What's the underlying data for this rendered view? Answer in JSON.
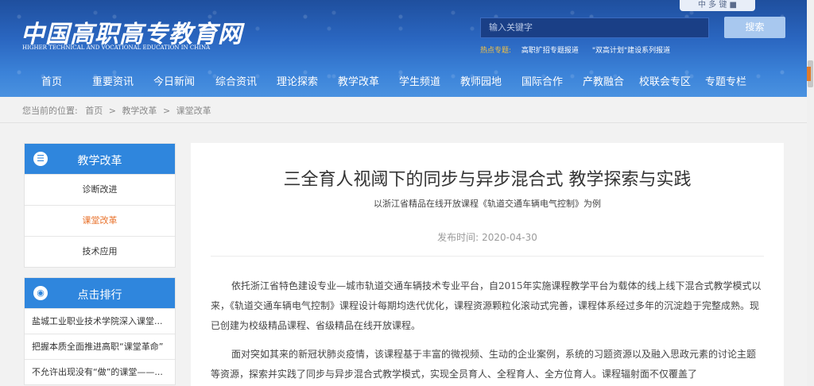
{
  "header": {
    "logo_cn": "中国高职高专教育网",
    "logo_en": "HIGHER TECHNICAL AND VOCATIONAL EDUCATION IN CHINA",
    "corner_badge": "中 多 键 ■",
    "search_placeholder": "输入关键字",
    "search_button": "搜索",
    "hot_label": "热点专题:",
    "hot_links": [
      "高职扩招专题报道",
      "\"双高计划\"建设系列报道"
    ],
    "nav": [
      "首页",
      "重要资讯",
      "今日新闻",
      "综合资讯",
      "理论探索",
      "教学改革",
      "学生频道",
      "教师园地",
      "国际合作",
      "产教融合",
      "校联会专区",
      "专题专栏"
    ]
  },
  "breadcrumb": {
    "prefix": "您当前的位置:",
    "items": [
      "首页",
      "教学改革",
      "课堂改革"
    ],
    "separator": ">"
  },
  "sidebar": {
    "category": {
      "icon": "list-icon",
      "title": "教学改革",
      "items": [
        "诊断改进",
        "课堂改革",
        "技术应用"
      ],
      "active": "课堂改革"
    },
    "ranking": {
      "icon": "target-icon",
      "title": "点击排行",
      "items": [
        "盐城工业职业技术学院深入课堂...",
        "把握本质全面推进高职“课堂革命”",
        "不允许出现没有“做”的课堂——..."
      ]
    }
  },
  "article": {
    "title": "三全育人视阈下的同步与异步混合式 教学探索与实践",
    "subtitle": "以浙江省精品在线开放课程《轨道交通车辆电气控制》为例",
    "date_label": "发布时间:",
    "date": "2020-04-30",
    "paragraphs": [
      "依托浙江省特色建设专业—城市轨道交通车辆技术专业平台，自2015年实施课程教学平台为载体的线上线下混合式教学模式以来，《轨道交通车辆电气控制》课程设计每期均迭代优化，课程资源颗粒化滚动式完善，课程体系经过多年的沉淀趋于完整成熟。现已创建为校级精品课程、省级精品在线开放课程。",
      "面对突如其来的新冠状肺炎疫情，该课程基于丰富的微视频、生动的企业案例，系统的习题资源以及融入思政元素的讨论主题等资源，探索并实践了同步与异步混合式教学模式，实现全员育人、全程育人、全方位育人。课程辐射面不仅覆盖了"
    ]
  },
  "colors": {
    "header_blue": "#2a66c0",
    "panel_blue": "#2f86dd",
    "active_orange": "#e8712a",
    "hot_label_yellow": "#f5c242"
  }
}
